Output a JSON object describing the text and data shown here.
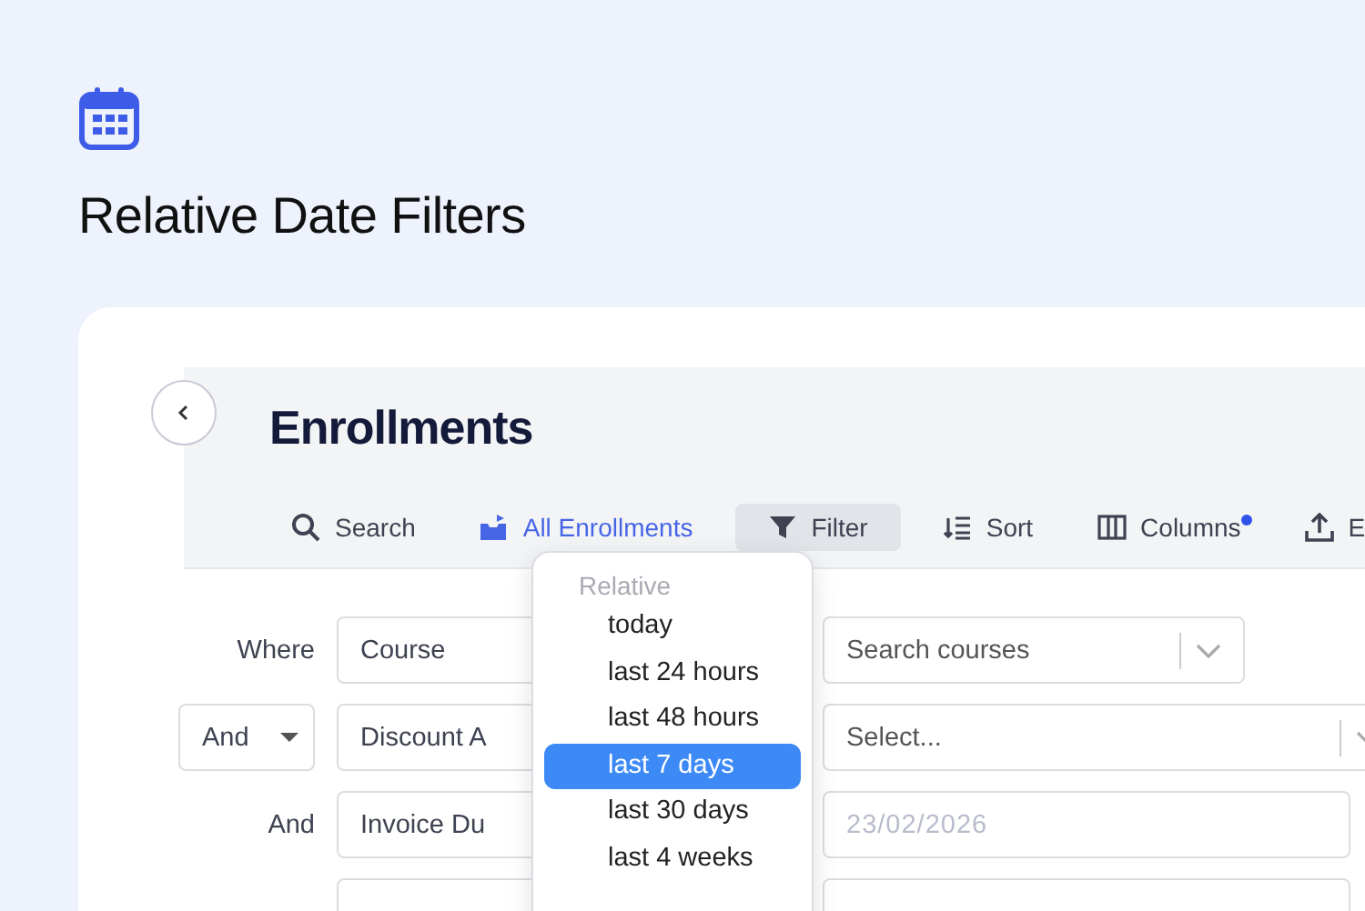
{
  "page_title": "Relative Date Filters",
  "panel": {
    "title": "Enrollments",
    "toolbar": [
      {
        "label": "Search",
        "kind": "plain",
        "open": false,
        "dot": false
      },
      {
        "label": "All Enrollments",
        "kind": "view",
        "open": false,
        "dot": false
      },
      {
        "label": "Filter",
        "kind": "plain",
        "open": true,
        "dot": false
      },
      {
        "label": "Sort",
        "kind": "plain",
        "open": false,
        "dot": false
      },
      {
        "label": "Columns",
        "kind": "plain",
        "open": false,
        "dot": true
      },
      {
        "label": "E",
        "kind": "plain",
        "open": false,
        "dot": false
      }
    ],
    "filters": [
      {
        "connector": {
          "kind": "label",
          "text": "Where"
        },
        "field": "Course",
        "value": {
          "kind": "search",
          "placeholder": "Search courses"
        }
      },
      {
        "connector": {
          "kind": "select",
          "text": "And"
        },
        "field": "Discount A",
        "value": {
          "kind": "select",
          "placeholder": "Select..."
        }
      },
      {
        "connector": {
          "kind": "label",
          "text": "And"
        },
        "field": "Invoice Du",
        "value": {
          "kind": "date",
          "placeholder": "23/02/2026"
        }
      }
    ],
    "dropdown": {
      "header": "Relative",
      "items": [
        {
          "label": "today",
          "selected": false
        },
        {
          "label": "last 24 hours",
          "selected": false
        },
        {
          "label": "last 48 hours",
          "selected": false
        },
        {
          "label": "last 7 days",
          "selected": true
        },
        {
          "label": "last 30 days",
          "selected": false
        },
        {
          "label": "last 4 weeks",
          "selected": false
        }
      ]
    }
  }
}
